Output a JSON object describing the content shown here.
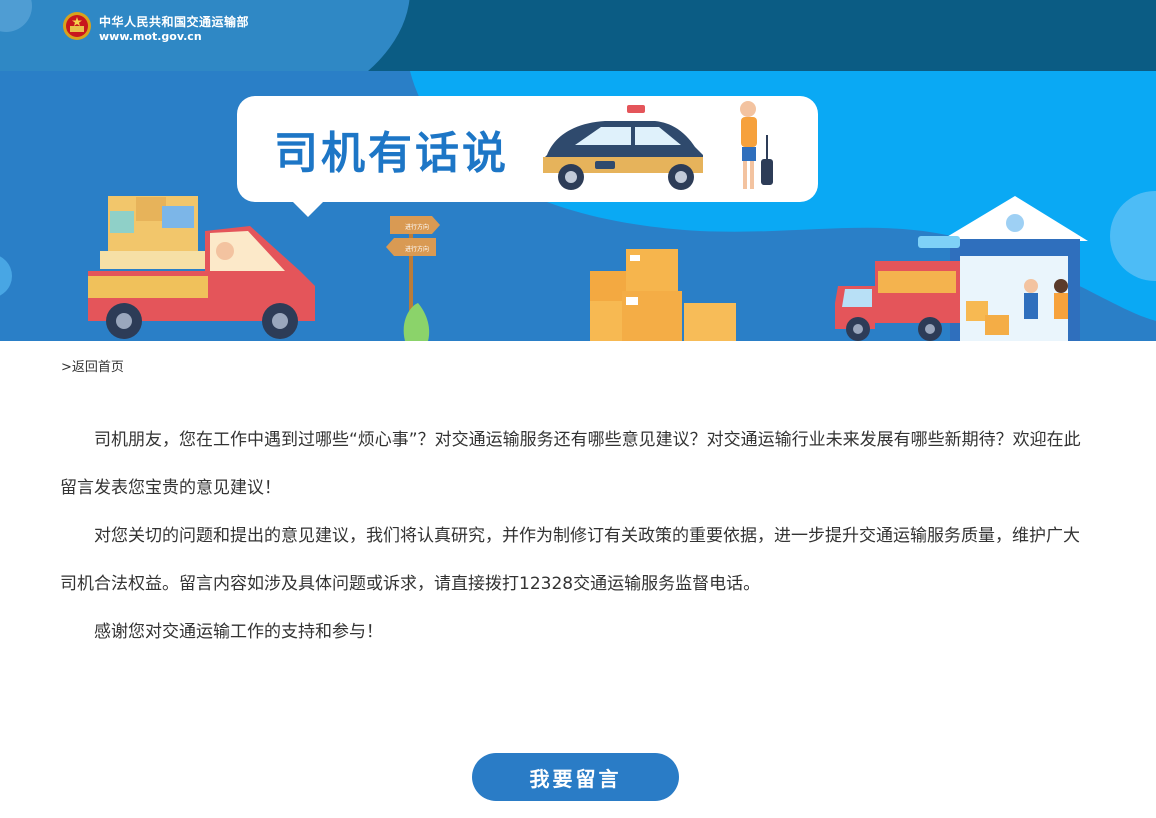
{
  "header": {
    "site_name": "中华人民共和国交通运输部",
    "site_url": "www.mot.gov.cn"
  },
  "banner": {
    "title": "司机有话说",
    "sign_top": "进行方向",
    "sign_bottom": "进行方向",
    "colors": {
      "sky": "#0aa9f4",
      "wave": "#2a7fc7",
      "truck": "#e4555a",
      "box": "#f4b34e"
    }
  },
  "breadcrumb": {
    "label": ">返回首页"
  },
  "article": {
    "paragraphs": [
      "司机朋友，您在工作中遇到过哪些“烦心事”？对交通运输服务还有哪些意见建议？对交通运输行业未来发展有哪些新期待？欢迎在此留言发表您宝贵的意见建议！",
      "对您关切的问题和提出的意见建议，我们将认真研究，并作为制修订有关政策的重要依据，进一步提升交通运输服务质量，维护广大司机合法权益。留言内容如涉及具体问题或诉求，请直接拨打12328交通运输服务监督电话。",
      "感谢您对交通运输工作的支持和参与！"
    ]
  },
  "cta": {
    "label": "我要留言"
  }
}
